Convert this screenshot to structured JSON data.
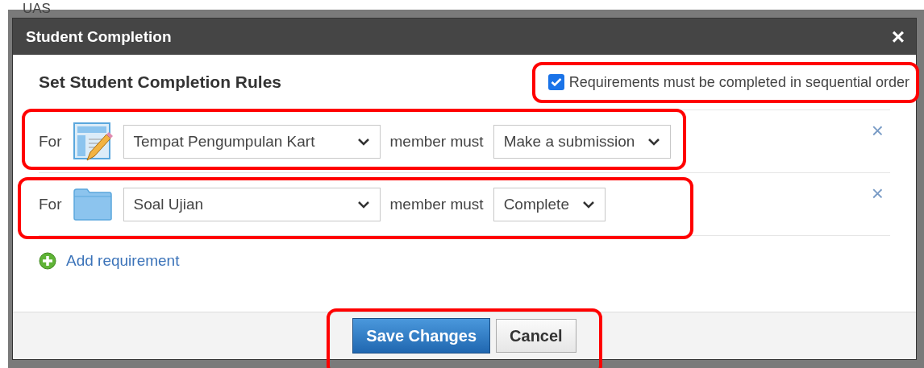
{
  "background": {
    "heading": "UAS"
  },
  "dialog": {
    "title": "Student Completion",
    "close": "×"
  },
  "heading": "Set Student Completion Rules",
  "sequential": {
    "label": "Requirements must be completed in sequential order",
    "checked": true,
    "highlighted": true
  },
  "requirements": [
    {
      "kind": "assignment",
      "for": "For",
      "item": "Tempat Pengumpulan Kart",
      "member_label": "member must",
      "action": "Make a submission",
      "remove": "×",
      "highlighted": true
    },
    {
      "kind": "folder",
      "for": "For",
      "item": "Soal Ujian",
      "member_label": "member must",
      "action": "Complete",
      "remove": "×",
      "highlighted": true
    }
  ],
  "add_requirement": "Add requirement",
  "footer": {
    "buttons": [
      {
        "label": "Save Changes",
        "kind": "primary"
      },
      {
        "label": "Cancel",
        "kind": "secondary"
      }
    ],
    "highlighted": true
  }
}
